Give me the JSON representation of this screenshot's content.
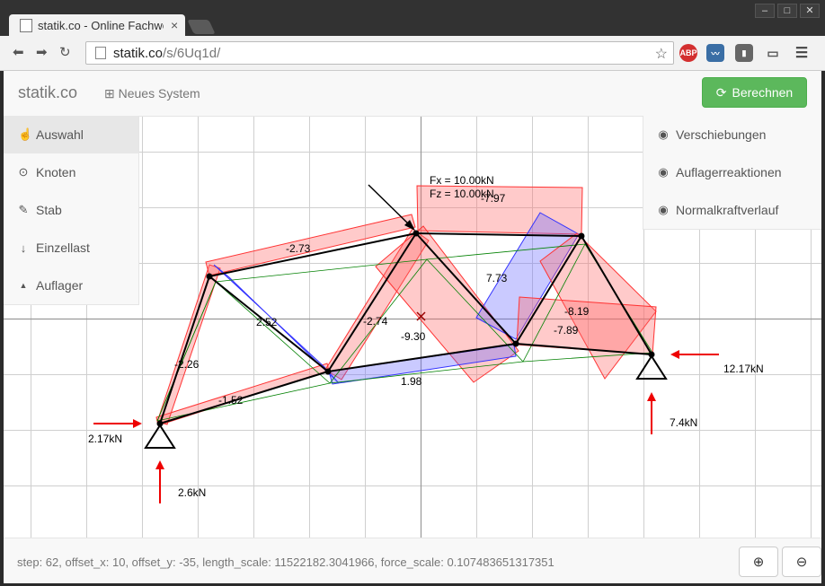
{
  "browser": {
    "tab_title": "statik.co - Online Fachwerk",
    "url_host": "statik.co",
    "url_path": "/s/6Uq1d/",
    "ext_abp": "ABP",
    "win_minimize": "–",
    "win_maximize": "□",
    "win_close": "✕"
  },
  "app": {
    "brand": "statik.co",
    "new_system_label": "Neues System",
    "run_button": "Berechnen"
  },
  "left_menu": [
    {
      "label": "Auswahl",
      "icon": "pointer-hand-icon",
      "active": true
    },
    {
      "label": "Knoten",
      "icon": "node-circle-icon",
      "active": false
    },
    {
      "label": "Stab",
      "icon": "pencil-icon",
      "active": false
    },
    {
      "label": "Einzellast",
      "icon": "arrow-down-icon",
      "active": false
    },
    {
      "label": "Auflager",
      "icon": "triangle-up-icon",
      "active": false
    }
  ],
  "right_menu": [
    {
      "label": "Verschiebungen",
      "icon": "eye-icon"
    },
    {
      "label": "Auflagerreaktionen",
      "icon": "eye-icon"
    },
    {
      "label": "Normalkraftverlauf",
      "icon": "eye-icon"
    }
  ],
  "truss": {
    "load_labels": [
      "Fx = 10.00kN",
      "Fz = 10.00kN"
    ],
    "member_forces": [
      "-2.73",
      "-7.97",
      "2.52",
      "-2.74",
      "7.73",
      "-2.26",
      "-9.30",
      "-8.19",
      "-7.89",
      "1.98",
      "-1.52"
    ],
    "reactions": [
      "2.17kN",
      "2.6kN",
      "12.17kN",
      "7.4kN"
    ],
    "colors": {
      "tension": "#ff6666",
      "compression": "#6666ff",
      "deformed": "#008000",
      "reaction_arrow": "#ee0000"
    }
  },
  "status": {
    "text": "step: 62, offset_x: 10, offset_y: -35, length_scale: 11522182.3041966, force_scale: 0.107483651317351"
  },
  "zoom": {
    "in_icon": "zoom-in-icon",
    "out_icon": "zoom-out-icon"
  }
}
